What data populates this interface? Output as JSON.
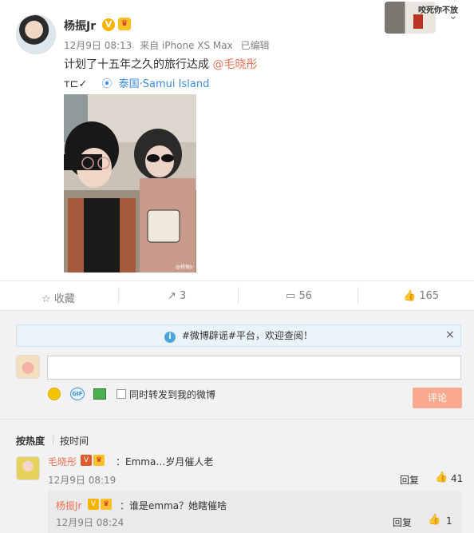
{
  "post": {
    "username": "杨振Jr",
    "verified_badge": "V",
    "meta": {
      "date": "12月9日 08:13",
      "source": "来自 iPhone XS Max",
      "edited": "已编辑"
    },
    "text": "计划了十五年之久的旅行达成",
    "mention": "@毛晓彤",
    "emoticon": "ᴛ⊏✓",
    "location_icon": "location-pin-icon",
    "location": "泰国·Samui Island",
    "corner_sticker_text": "咬死你不放"
  },
  "actions": {
    "favorite": "收藏",
    "repost_count": "3",
    "comment_count": "56",
    "like_count": "165"
  },
  "notice": {
    "text": "#微博辟谣#平台，欢迎查阅！",
    "close": "×",
    "info_icon": "i"
  },
  "composer": {
    "placeholder": "",
    "gif_label": "GIF",
    "repost_checkbox_label": "同时转发到我的微博",
    "submit_label": "评论"
  },
  "sort": {
    "hot": "按热度",
    "time": "按时间"
  },
  "comments": [
    {
      "name": "毛晓彤",
      "badge_v": "V",
      "text": "：Emma…岁月催人老",
      "time": "12月9日 08:19",
      "reply_label": "回复",
      "likes": "41",
      "reply": {
        "name": "杨振Jr",
        "badge_v": "V",
        "text": "：谁是emma？她瞎催啥",
        "time": "12月9日 08:24",
        "reply_label": "回复",
        "likes": "1"
      }
    }
  ],
  "colors": {
    "accent": "#eb7350",
    "link": "#3a8ee6",
    "badge": "#f7b500"
  }
}
